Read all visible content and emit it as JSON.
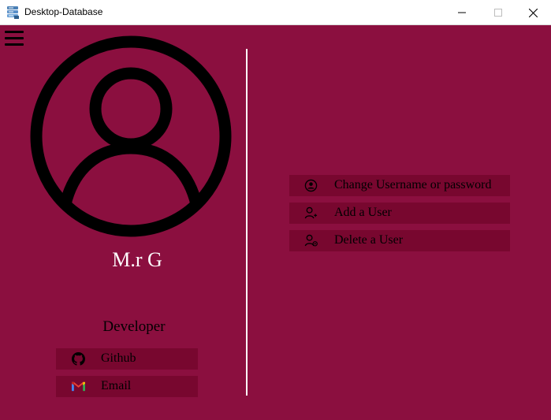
{
  "window": {
    "title": "Desktop-Database",
    "controls": {
      "minimize_icon": "minimize-icon",
      "maximize_icon": "maximize-icon",
      "close_icon": "close-icon"
    }
  },
  "colors": {
    "background": "#8b0f3f",
    "button_background": "#78072f",
    "divider": "#ffffff",
    "username_text": "#ffffff"
  },
  "menu": {
    "icon": "hamburger-menu-icon"
  },
  "profile": {
    "avatar_icon": "user-avatar-icon",
    "username": "M.r G",
    "role": "Developer"
  },
  "links": [
    {
      "label": "Github",
      "icon": "github-icon"
    },
    {
      "label": "Email",
      "icon": "gmail-icon"
    }
  ],
  "actions": [
    {
      "label": "Change Username or password",
      "icon": "user-circle-icon"
    },
    {
      "label": "Add a User",
      "icon": "user-add-icon"
    },
    {
      "label": "Delete a User",
      "icon": "user-remove-icon"
    }
  ]
}
